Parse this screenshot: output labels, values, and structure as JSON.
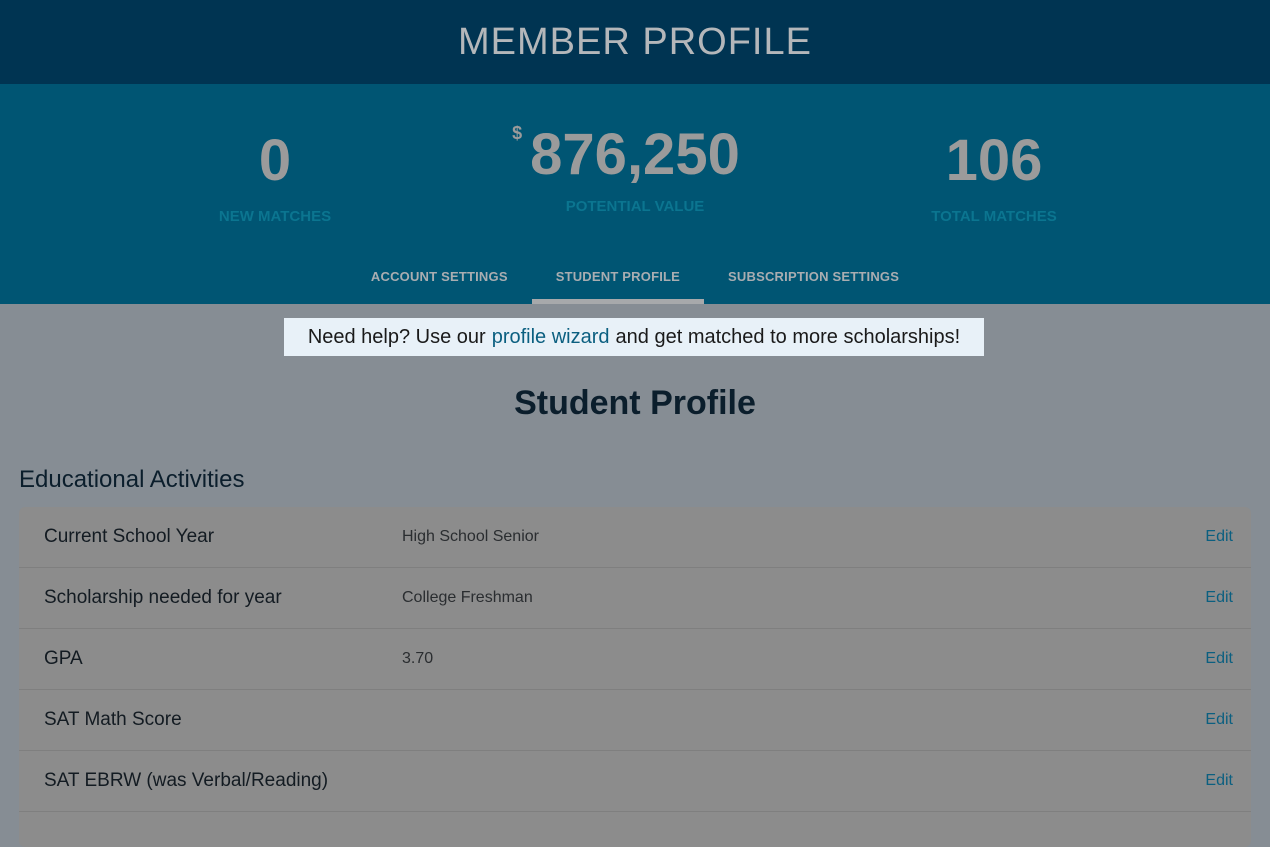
{
  "header": {
    "title": "MEMBER PROFILE"
  },
  "stats": {
    "new_matches": {
      "value": "0",
      "label": "NEW MATCHES"
    },
    "potential_value": {
      "currency": "$",
      "value": "876,250",
      "label": "POTENTIAL VALUE"
    },
    "total_matches": {
      "value": "106",
      "label": "TOTAL MATCHES"
    }
  },
  "tabs": [
    {
      "label": "ACCOUNT SETTINGS"
    },
    {
      "label": "STUDENT PROFILE",
      "active": true
    },
    {
      "label": "SUBSCRIPTION SETTINGS"
    }
  ],
  "help": {
    "before": "Need help? Use our",
    "link": "profile wizard",
    "after": "and get matched to more scholarships!"
  },
  "main": {
    "title": "Student Profile",
    "section": {
      "title": "Educational Activities",
      "rows": [
        {
          "field": "Current School Year",
          "value": "High School Senior",
          "action": "Edit"
        },
        {
          "field": "Scholarship needed for year",
          "value": "College Freshman",
          "action": "Edit"
        },
        {
          "field": "GPA",
          "value": "3.70",
          "action": "Edit"
        },
        {
          "field": "SAT Math Score",
          "value": "",
          "action": "Edit"
        },
        {
          "field": "SAT EBRW (was Verbal/Reading)",
          "value": "",
          "action": "Edit"
        }
      ]
    }
  },
  "colors": {
    "header_bg": "#003452",
    "stats_bg": "#005573",
    "link": "#0b5f80"
  }
}
